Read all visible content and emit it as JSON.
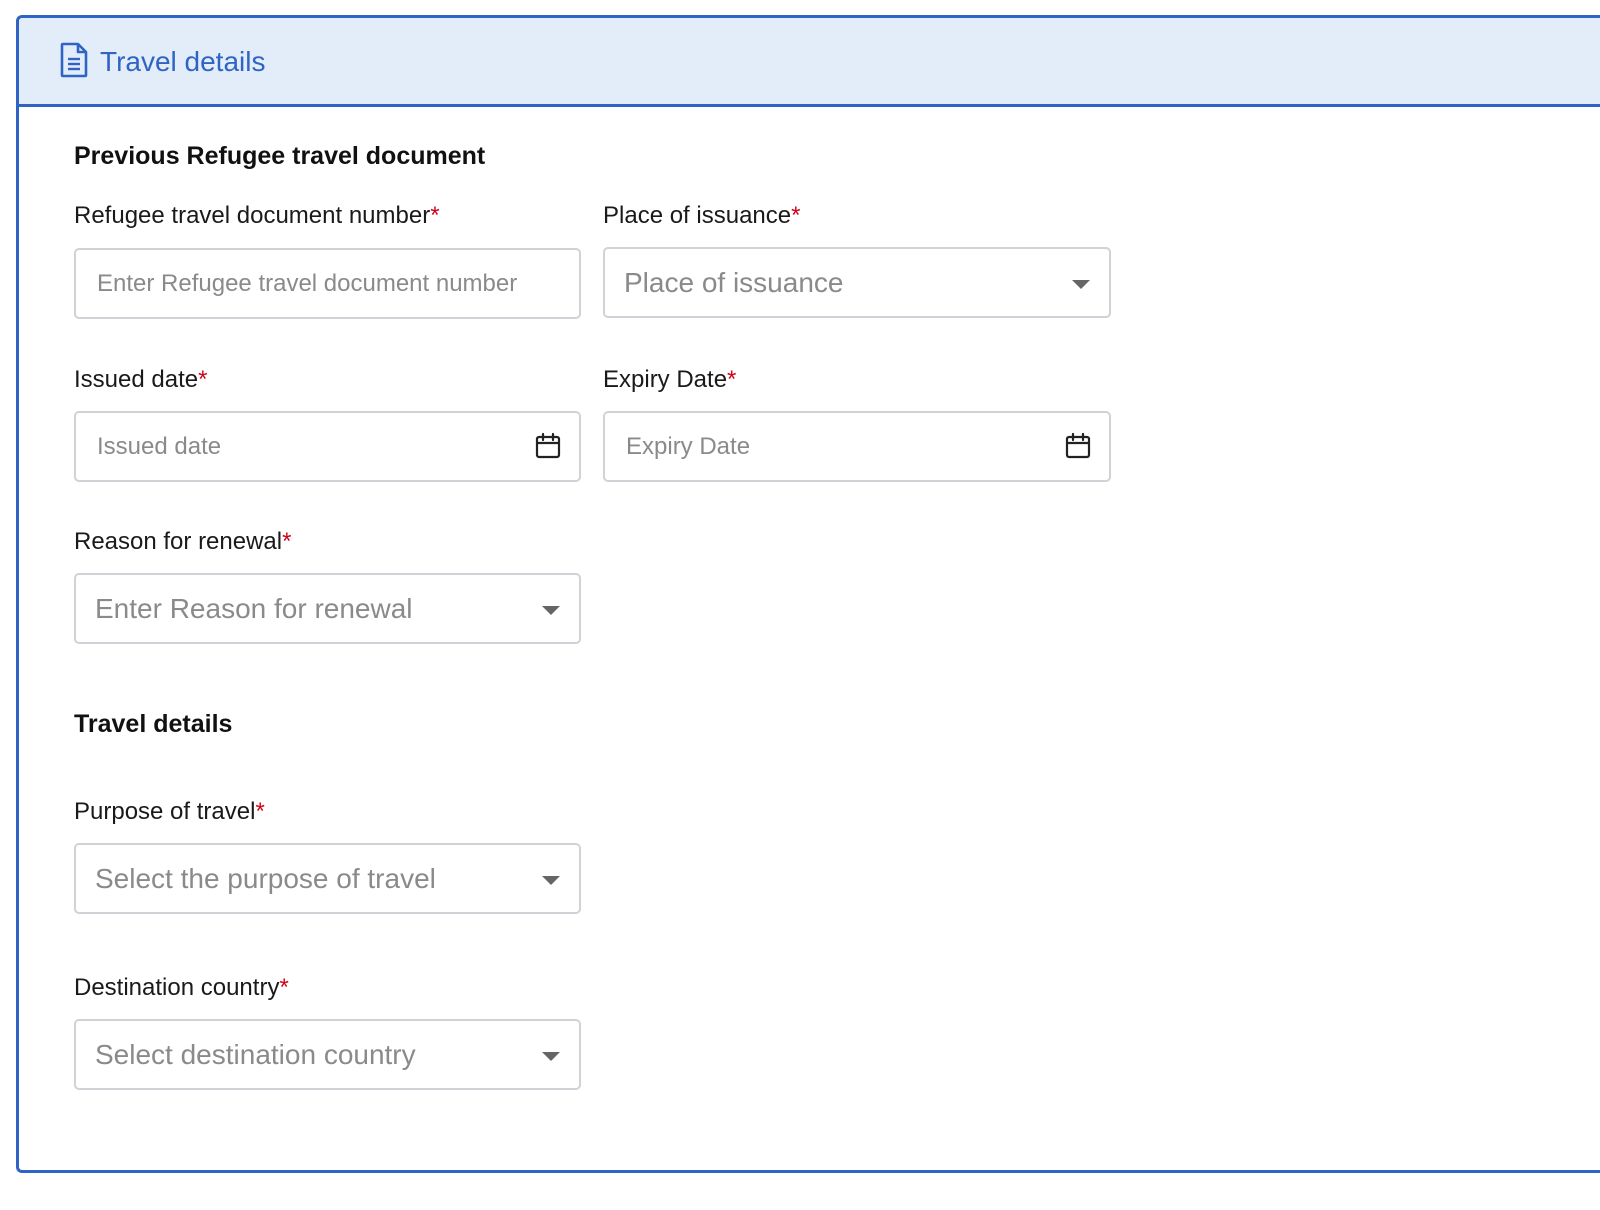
{
  "header": {
    "title": "Travel details",
    "icon": "document-icon",
    "accent_color": "#2f63c4",
    "background_color": "#e3edf9"
  },
  "sections": {
    "previous_document": {
      "title": "Previous Refugee travel document",
      "doc_number": {
        "label": "Refugee travel document number",
        "required_mark": "*",
        "placeholder": "Enter Refugee travel document number",
        "value": ""
      },
      "place_of_issuance": {
        "label": "Place of issuance",
        "required_mark": "*",
        "placeholder": "Place of issuance"
      },
      "issued_date": {
        "label": "Issued date",
        "required_mark": "*",
        "placeholder": "Issued date",
        "value": "",
        "icon": "calendar-icon"
      },
      "expiry_date": {
        "label": "Expiry Date",
        "required_mark": "*",
        "placeholder": "Expiry Date",
        "value": "",
        "icon": "calendar-icon"
      },
      "reason_for_renewal": {
        "label": "Reason for renewal",
        "required_mark": "*",
        "placeholder": "Enter Reason for renewal"
      }
    },
    "travel_details": {
      "title": "Travel details",
      "purpose_of_travel": {
        "label": "Purpose of travel",
        "required_mark": "*",
        "placeholder": "Select the purpose of travel"
      },
      "destination_country": {
        "label": "Destination country",
        "required_mark": "*",
        "placeholder": "Select destination country"
      }
    }
  },
  "colors": {
    "required": "#d0021b",
    "placeholder": "#8a8a8a",
    "border": "#cfd2d6"
  }
}
